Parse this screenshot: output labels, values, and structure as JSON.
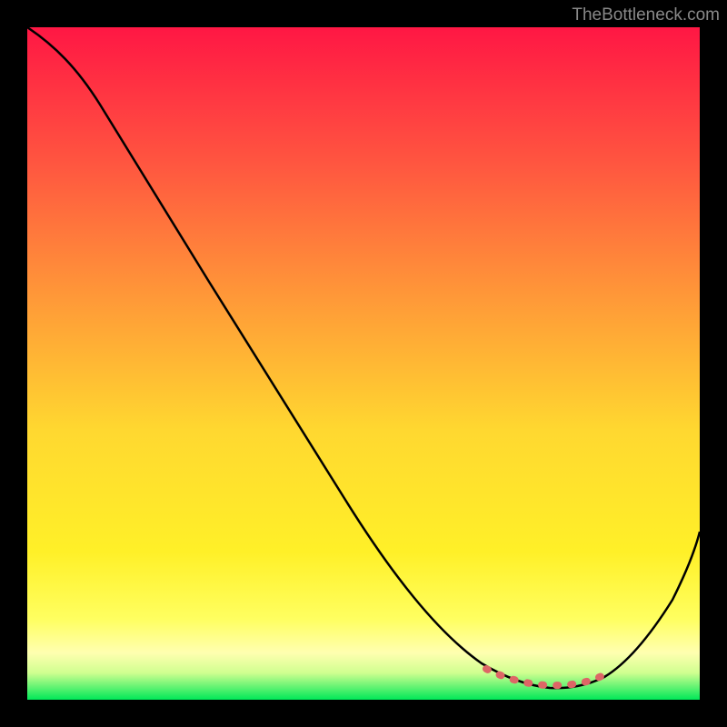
{
  "watermark": "TheBottleneck.com",
  "chart_data": {
    "type": "line",
    "title": "",
    "xlabel": "",
    "ylabel": "",
    "xlim": [
      0,
      100
    ],
    "ylim": [
      0,
      100
    ],
    "series": [
      {
        "name": "bottleneck-curve",
        "x": [
          0,
          5,
          10,
          15,
          20,
          25,
          30,
          35,
          40,
          45,
          50,
          55,
          60,
          65,
          70,
          72,
          74,
          76,
          78,
          80,
          82,
          84,
          86,
          88,
          90,
          92,
          94,
          96,
          98,
          100
        ],
        "y": [
          100,
          97,
          93,
          88,
          82,
          75,
          68,
          61,
          54,
          47,
          40,
          33,
          26,
          19,
          12,
          9,
          6,
          4,
          2.5,
          1.8,
          1.5,
          1.8,
          2.5,
          4,
          7,
          11,
          16,
          22,
          28,
          35
        ]
      },
      {
        "name": "optimal-zone-marker",
        "x": [
          72,
          74,
          76,
          78,
          80,
          82,
          84,
          86
        ],
        "y": [
          3,
          2.5,
          2,
          1.8,
          1.8,
          2,
          2.5,
          3
        ]
      }
    ],
    "gradient_stops": [
      {
        "offset": 0,
        "color": "#ff1744"
      },
      {
        "offset": 20,
        "color": "#ff5540"
      },
      {
        "offset": 40,
        "color": "#ff9838"
      },
      {
        "offset": 60,
        "color": "#ffd830"
      },
      {
        "offset": 78,
        "color": "#fff028"
      },
      {
        "offset": 88,
        "color": "#ffff60"
      },
      {
        "offset": 93,
        "color": "#ffffb0"
      },
      {
        "offset": 96,
        "color": "#d0ff90"
      },
      {
        "offset": 100,
        "color": "#00e858"
      }
    ]
  }
}
